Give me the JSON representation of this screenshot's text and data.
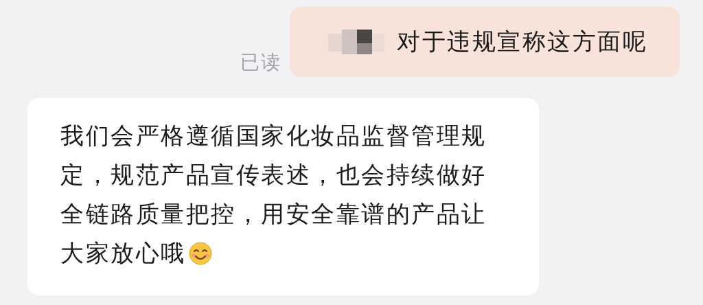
{
  "messages": [
    {
      "kind": "sent",
      "redacted": true,
      "text": "对于违规宣称这方面呢",
      "status": "已读"
    },
    {
      "kind": "received",
      "lines": [
        "我们会严格遵循国家化妆品监督管理规",
        "定，规范产品宣传表述，也会持续做好",
        "全链路质量把控，用安全靠谱的产品让",
        "大家放心哦"
      ],
      "emoji": true
    }
  ]
}
